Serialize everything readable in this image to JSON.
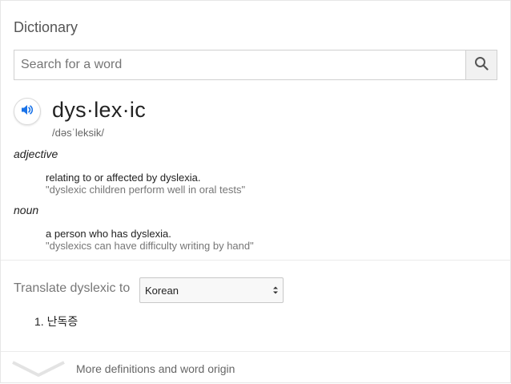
{
  "header": {
    "title": "Dictionary"
  },
  "search": {
    "placeholder": "Search for a word",
    "value": ""
  },
  "entry": {
    "word": "dys·lex·ic",
    "phonetic": "/dəsˈleksik/",
    "senses": [
      {
        "part_of_speech": "adjective",
        "definition": "relating to or affected by dyslexia.",
        "example": "\"dyslexic children perform well in oral tests\""
      },
      {
        "part_of_speech": "noun",
        "definition": "a person who has dyslexia.",
        "example": "\"dyslexics can have difficulty writing by hand\""
      }
    ]
  },
  "translate": {
    "label": "Translate dyslexic to",
    "selected_language": "Korean",
    "results": [
      "1. 난독증"
    ]
  },
  "footer": {
    "more_label": "More definitions and word origin"
  },
  "icons": {
    "search": "search-icon",
    "speaker": "speaker-icon",
    "select_arrows": "select-arrows-icon",
    "expand": "chevron-down-icon"
  },
  "colors": {
    "speaker_blue": "#1a73e8",
    "muted_text": "#767676"
  }
}
